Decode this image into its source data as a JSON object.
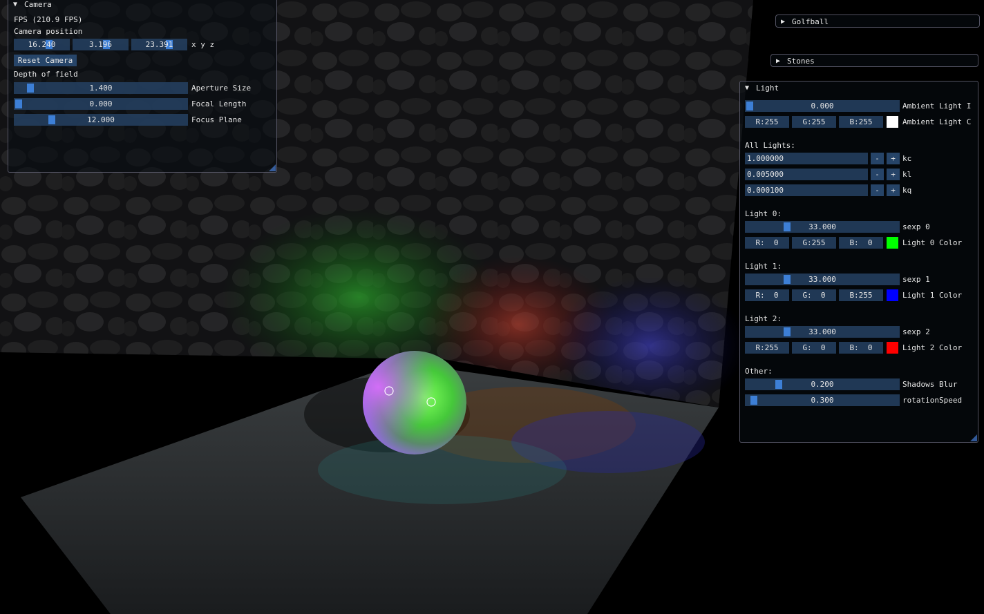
{
  "camera_window": {
    "title": "Camera",
    "fps_text": "FPS (210.9 FPS)",
    "position_label": "Camera position",
    "position_values": [
      "16.240",
      "3.196",
      "23.391"
    ],
    "position_suffix": "x y z",
    "reset_button": "Reset Camera",
    "dof_label": "Depth of field",
    "aperture": {
      "value": "1.400",
      "label": "Aperture Size"
    },
    "focal_length": {
      "value": "0.000",
      "label": "Focal Length"
    },
    "focus_plane": {
      "value": "12.000",
      "label": "Focus Plane"
    }
  },
  "golfball_header": {
    "title": "Golfball"
  },
  "stones_header": {
    "title": "Stones"
  },
  "light_window": {
    "title": "Light",
    "ambient_intensity": {
      "value": "0.000",
      "label": "Ambient Light I"
    },
    "ambient_color": {
      "r": "R:255",
      "g": "G:255",
      "b": "B:255",
      "label": "Ambient Light C",
      "swatch": "#ffffff"
    },
    "all_lights_label": "All Lights:",
    "kc": {
      "value": "1.000000",
      "minus": "-",
      "plus": "+",
      "label": "kc"
    },
    "kl": {
      "value": "0.005000",
      "minus": "-",
      "plus": "+",
      "label": "kl"
    },
    "kq": {
      "value": "0.000100",
      "minus": "-",
      "plus": "+",
      "label": "kq"
    },
    "light0": {
      "heading": "Light 0:",
      "sexp": "33.000",
      "sexp_label": "sexp 0",
      "r": "R:  0",
      "g": "G:255",
      "b": "B:  0",
      "color_label": "Light 0 Color",
      "swatch": "#00ff00"
    },
    "light1": {
      "heading": "Light 1:",
      "sexp": "33.000",
      "sexp_label": "sexp 1",
      "r": "R:  0",
      "g": "G:  0",
      "b": "B:255",
      "color_label": "Light 1 Color",
      "swatch": "#0000ff"
    },
    "light2": {
      "heading": "Light 2:",
      "sexp": "33.000",
      "sexp_label": "sexp 2",
      "r": "R:255",
      "g": "G:  0",
      "b": "B:  0",
      "color_label": "Light 2 Color",
      "swatch": "#ff0000"
    },
    "other_label": "Other:",
    "shadows_blur": {
      "value": "0.200",
      "label": "Shadows Blur"
    },
    "rotation_speed": {
      "value": "0.300",
      "label": "rotationSpeed"
    }
  },
  "colors": {
    "accent": "#3d7fd6",
    "field_bg": "#244060",
    "panel_border": "#6e6e82"
  }
}
